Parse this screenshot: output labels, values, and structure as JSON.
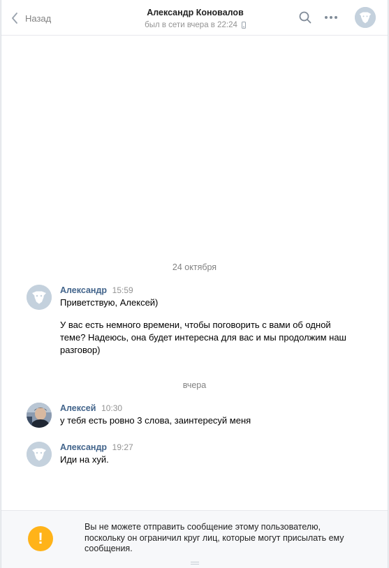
{
  "header": {
    "back_label": "Назад",
    "contact_name": "Александр Коновалов",
    "status": "был в сети вчера в 22:24"
  },
  "history": {
    "date_separators": [
      "24 октября",
      "вчера"
    ],
    "messages": [
      {
        "author": "Александр",
        "time": "15:59",
        "text_1": "Приветствую, Алексей)",
        "text_2": "У вас есть немного времени, чтобы поговорить с вами об одной теме? Надеюсь, она будет интересна для вас и мы продолжим наш разговор)",
        "avatar": "default-dog-avatar"
      },
      {
        "author": "Алексей",
        "time": "10:30",
        "text_1": "у тебя есть ровно 3 слова, заинтересуй меня",
        "avatar": "user-photo-avatar"
      },
      {
        "author": "Александр",
        "time": "19:27",
        "text_1": "Иди на хуй.",
        "avatar": "default-dog-avatar"
      }
    ]
  },
  "notice": {
    "icon": "!",
    "text": "Вы не можете отправить сообщение этому пользователю, поскольку он ограничил круг лиц, которые могут присылать ему сообщения."
  },
  "colors": {
    "author_link": "#42648b",
    "warning": "#ffb319",
    "avatar_bg": "#c4d1dd"
  }
}
